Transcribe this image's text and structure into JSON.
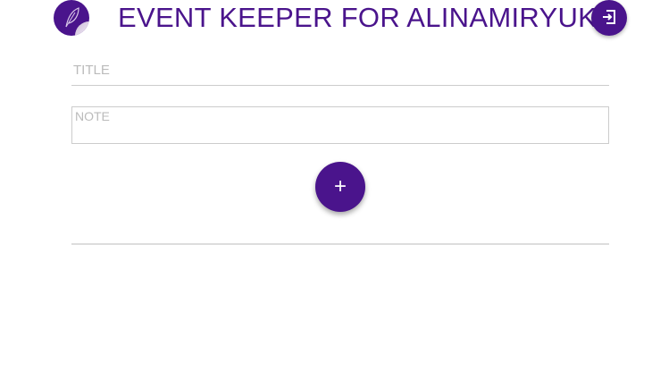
{
  "header": {
    "title": "EVENT KEEPER FOR ALINAMIRYUK"
  },
  "form": {
    "title_placeholder": "TITLE",
    "title_value": "",
    "note_placeholder": "NOTE",
    "note_value": "",
    "add_label": "+"
  }
}
